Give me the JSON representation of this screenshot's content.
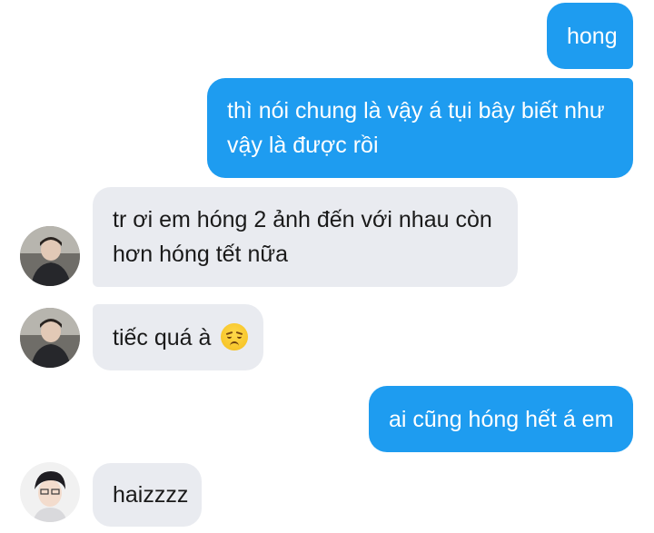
{
  "messages": [
    {
      "id": "m1",
      "side": "out",
      "lines": [
        "hong"
      ]
    },
    {
      "id": "m2",
      "side": "out",
      "lines": [
        "thì nói chung là vậy á tụi bây biết như",
        "vậy là được rồi"
      ]
    },
    {
      "id": "m3",
      "side": "in",
      "lines": [
        "tr ơi em hóng 2 ảnh đến với nhau còn",
        "hơn hóng tết nữa"
      ]
    },
    {
      "id": "m4",
      "side": "in",
      "lines": [
        "tiếc quá à"
      ],
      "emoji": "disappointed-face-emoji"
    },
    {
      "id": "m5",
      "side": "out",
      "lines": [
        "ai cũng hóng hết á em"
      ]
    },
    {
      "id": "m6",
      "side": "in",
      "lines": [
        "haizzzz"
      ]
    }
  ],
  "colors": {
    "outgoing_bubble": "#1e9cf0",
    "incoming_bubble": "#e9ebf0",
    "background": "#ffffff"
  }
}
